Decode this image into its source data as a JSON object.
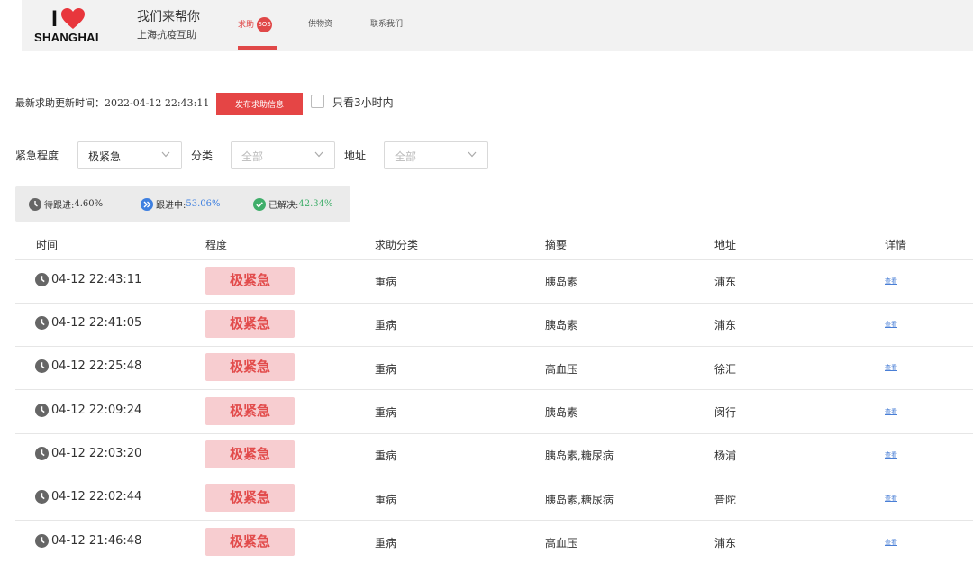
{
  "header": {
    "logo_top": "I",
    "logo_city": "SHANGHAI",
    "brand_title": "我们来帮你",
    "brand_sub": "上海抗疫互助",
    "nav": {
      "help": "求助",
      "sos": "SOS",
      "supply": "供物资",
      "contact": "联系我们"
    }
  },
  "toolbar": {
    "update_time": "最新求助更新时间：2022-04-12 22:43:11",
    "publish_label": "发布求助信息",
    "only3h_label": "只看3小时内"
  },
  "filters": {
    "urgency_label": "紧急程度",
    "urgency_value": "极紧急",
    "category_label": "分类",
    "category_placeholder": "全部",
    "address_label": "地址",
    "address_placeholder": "全部"
  },
  "stats": {
    "pending_label": "待跟进:",
    "pending_value": "4.60%",
    "following_label": "跟进中:",
    "following_value": "53.06%",
    "resolved_label": "已解决:",
    "resolved_value": "42.34%"
  },
  "table": {
    "headers": [
      "时间",
      "程度",
      "求助分类",
      "摘要",
      "地址",
      "详情"
    ],
    "rows": [
      {
        "time": "04-12 22:43:11",
        "level": "极紧急",
        "category": "重病",
        "summary": "胰岛素",
        "address": "浦东",
        "detail": "查看"
      },
      {
        "time": "04-12 22:41:05",
        "level": "极紧急",
        "category": "重病",
        "summary": "胰岛素",
        "address": "浦东",
        "detail": "查看"
      },
      {
        "time": "04-12 22:25:48",
        "level": "极紧急",
        "category": "重病",
        "summary": "高血压",
        "address": "徐汇",
        "detail": "查看"
      },
      {
        "time": "04-12 22:09:24",
        "level": "极紧急",
        "category": "重病",
        "summary": "胰岛素",
        "address": "闵行",
        "detail": "查看"
      },
      {
        "time": "04-12 22:03:20",
        "level": "极紧急",
        "category": "重病",
        "summary": "胰岛素,糖尿病",
        "address": "杨浦",
        "detail": "查看"
      },
      {
        "time": "04-12 22:02:44",
        "level": "极紧急",
        "category": "重病",
        "summary": "胰岛素,糖尿病",
        "address": "普陀",
        "detail": "查看"
      },
      {
        "time": "04-12 21:46:48",
        "level": "极紧急",
        "category": "重病",
        "summary": "高血压",
        "address": "浦东",
        "detail": "查看"
      }
    ]
  },
  "colors": {
    "accent": "#e54545",
    "badge_bg": "#f7cdd0",
    "badge_text": "#e24b4b",
    "following": "#3d7fe0",
    "resolved": "#3fae6a"
  }
}
